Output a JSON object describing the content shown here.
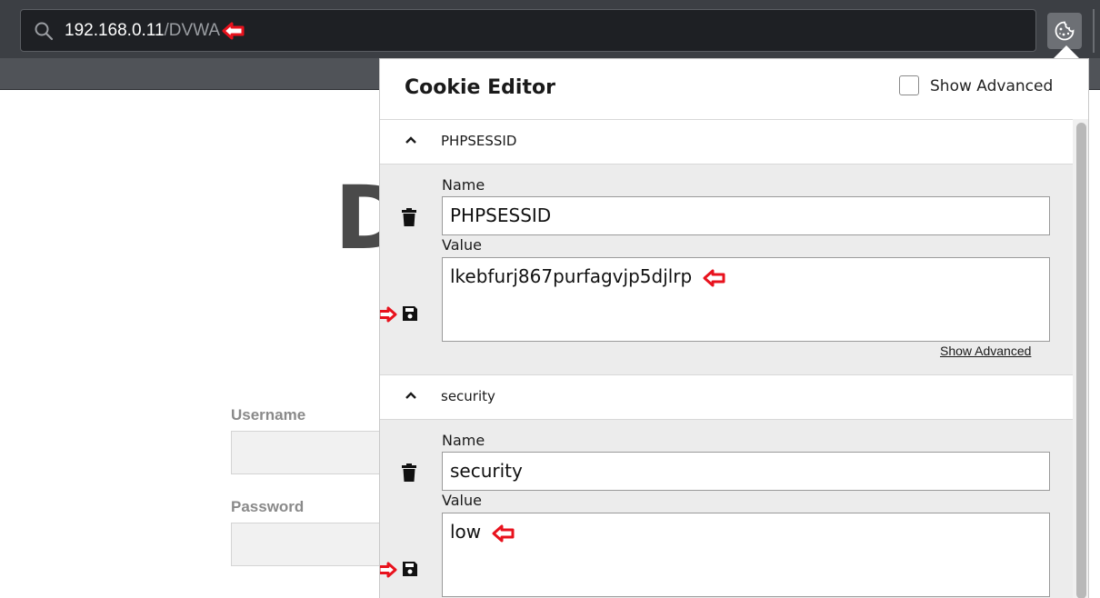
{
  "browser": {
    "url_host": "192.168.0.11",
    "url_path": "/DVWA",
    "icons": {
      "search": "search-icon",
      "extension": "cookie-icon",
      "annotation": "red-arrow-icon"
    },
    "colors": {
      "annotation": "#e8121d",
      "toolbar": "#3c3f44"
    }
  },
  "page": {
    "logo_partial": "D",
    "username_label": "Username",
    "password_label": "Password"
  },
  "cookie_editor": {
    "title": "Cookie Editor",
    "show_advanced_label": "Show Advanced",
    "cookies": [
      {
        "header": "PHPSESSID",
        "name_label": "Name",
        "name": "PHPSESSID",
        "value_label": "Value",
        "value": "lkebfurj867purfagvjp5djlrp",
        "show_advanced_link": "Show Advanced"
      },
      {
        "header": "security",
        "name_label": "Name",
        "name": "security",
        "value_label": "Value",
        "value": "low"
      }
    ]
  }
}
